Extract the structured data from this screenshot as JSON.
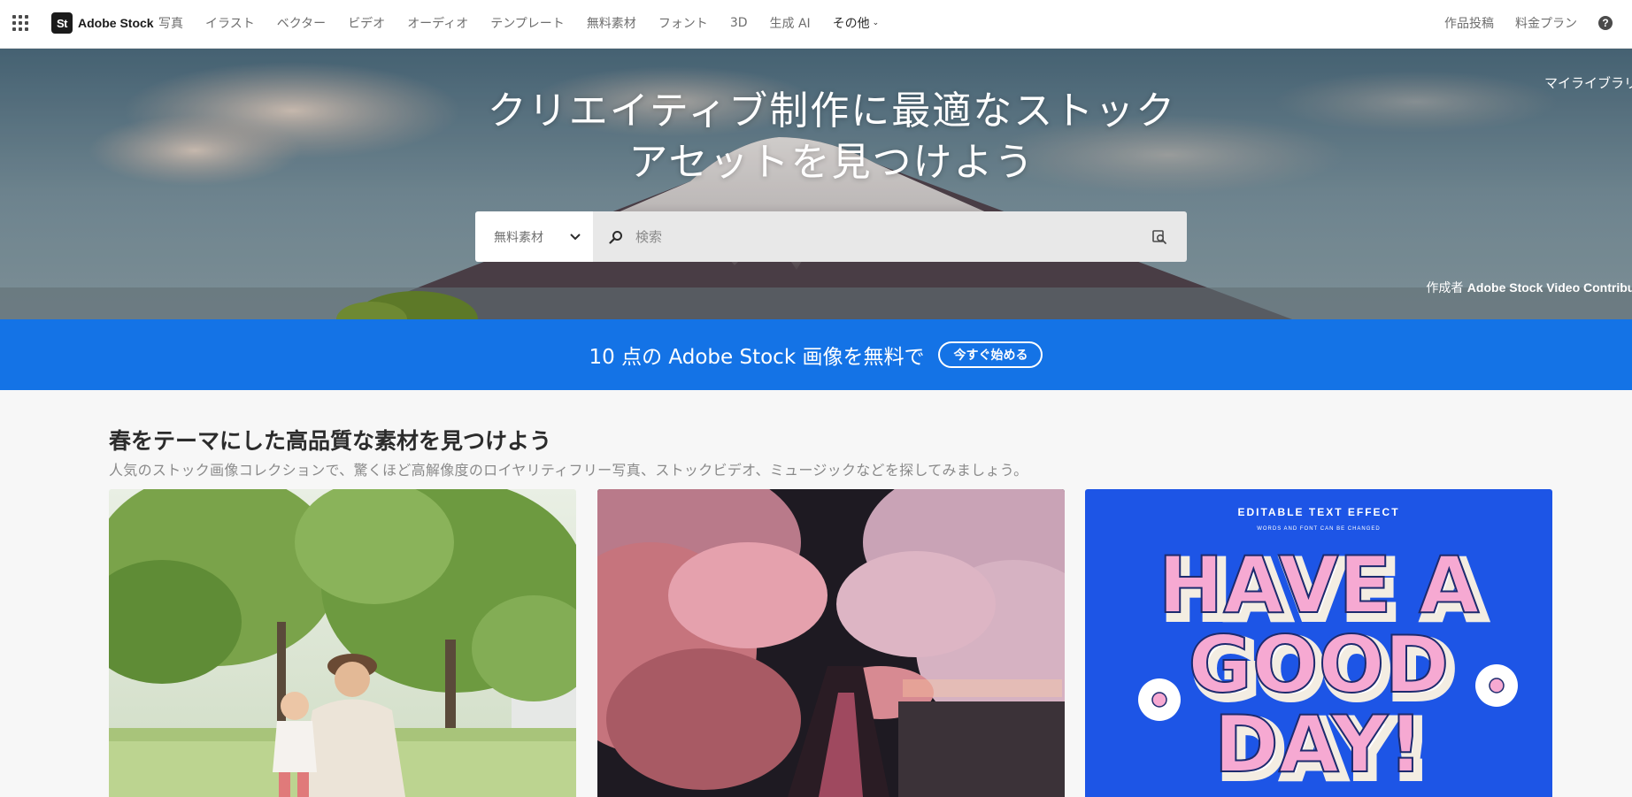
{
  "header": {
    "app_switcher_icon": "grid-icon",
    "logo": {
      "mark": "St",
      "text": "Adobe Stock"
    },
    "nav_items": [
      {
        "label": "写真"
      },
      {
        "label": "イラスト"
      },
      {
        "label": "ベクター"
      },
      {
        "label": "ビデオ"
      },
      {
        "label": "オーディオ"
      },
      {
        "label": "テンプレート"
      },
      {
        "label": "無料素材"
      },
      {
        "label": "フォント"
      },
      {
        "label": "3D"
      },
      {
        "label": "生成 AI"
      }
    ],
    "more_label": "その他",
    "right_links": {
      "contribute": "作品投稿",
      "pricing": "料金プラン"
    },
    "help_icon": "question-circle-icon"
  },
  "hero": {
    "title_line1": "クリエイティブ制作に最適なストック",
    "title_line2": "アセットを見つけよう",
    "my_library": "マイライブラリ",
    "credit_prefix": "作成者",
    "credit_name": "Adobe Stock Video Contribut",
    "search": {
      "filter_value": "無料素材",
      "placeholder": "検索",
      "value": ""
    }
  },
  "promo": {
    "text": "10 点の Adobe Stock 画像を無料で",
    "button": "今すぐ始める",
    "color": "#1473e6"
  },
  "section": {
    "title": "春をテーマにした高品質な素材を見つけよう",
    "subtitle": "人気のストック画像コレクションで、驚くほど高解像度のロイヤリティフリー写真、ストックビデオ、ミュージックなどを探してみましょう。",
    "cards": [
      {
        "kind": "photo"
      },
      {
        "kind": "photo"
      },
      {
        "kind": "illustration",
        "header": "EDITABLE TEXT EFFECT",
        "subheader": "WORDS AND FONT CAN BE CHANGED",
        "line1": "HAVE A",
        "line2": "GOOD",
        "line3": "DAY!"
      }
    ]
  }
}
